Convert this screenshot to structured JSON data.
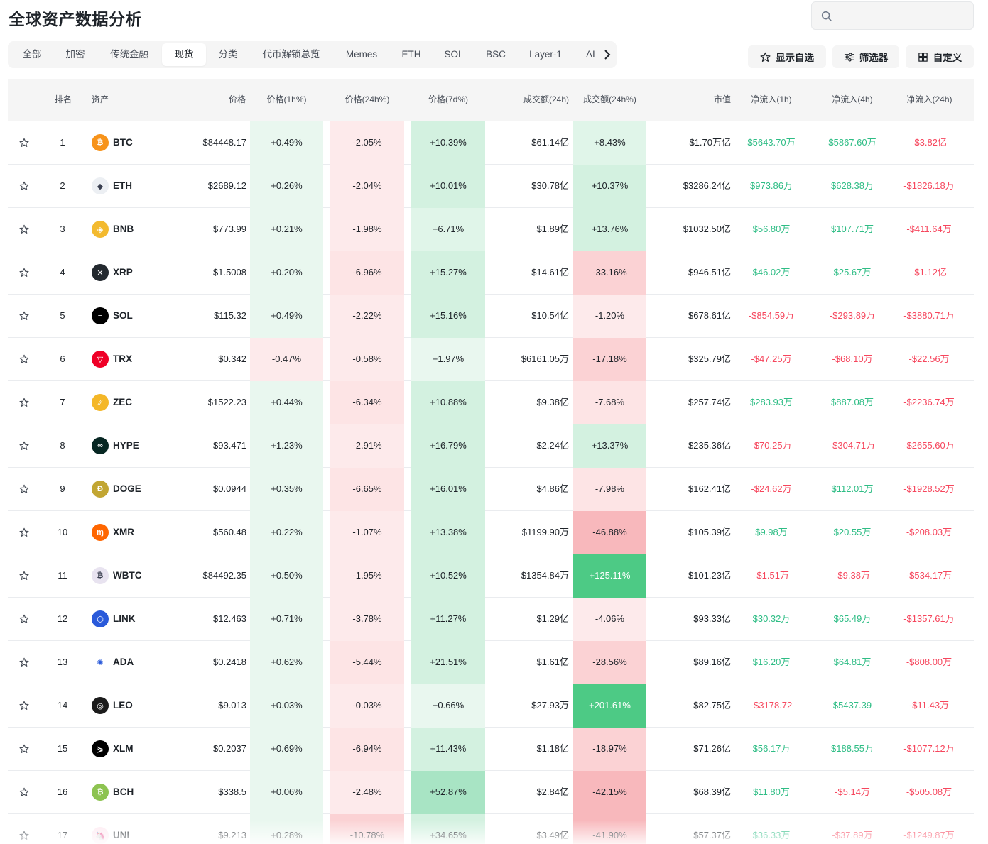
{
  "page": {
    "title": "全球资产数据分析"
  },
  "search": {
    "placeholder": ""
  },
  "tabs": [
    "全部",
    "加密",
    "传统金融",
    "现货",
    "分类",
    "代币解锁总览",
    "Memes",
    "ETH",
    "SOL",
    "BSC",
    "Layer-1",
    "AI"
  ],
  "active_tab": "现货",
  "toolbar": {
    "watchlist": "显示自选",
    "filter": "筛选器",
    "customize": "自定义"
  },
  "headers": {
    "rank": "排名",
    "asset": "资产",
    "price": "价格",
    "chg1h": "价格(1h%)",
    "chg24h": "价格(24h%)",
    "chg7d": "价格(7d%)",
    "vol": "成交额(24h)",
    "volchg": "成交额(24h%)",
    "mcap": "市值",
    "flow1h": "净流入(1h)",
    "flow4h": "净流入(4h)",
    "flow24h": "净流入(24h)"
  },
  "colors": {
    "up": "#2ebd85",
    "down": "#f6465d"
  },
  "rows": [
    {
      "rank": "1",
      "symbol": "BTC",
      "icon": "bitcoin-icon",
      "icon_color": "#f7931a",
      "glyph": "₿",
      "price": "$84448.17",
      "chg1h": "+0.49%",
      "chg24h": "-2.05%",
      "chg7d": "+10.39%",
      "vol": "$61.14亿",
      "volchg": "+8.43%",
      "mcap": "$1.70万亿",
      "flow1h": "$5643.70万",
      "flow4h": "$5867.60万",
      "flow24h": "-$3.82亿"
    },
    {
      "rank": "2",
      "symbol": "ETH",
      "icon": "ethereum-icon",
      "icon_color": "#eceff3",
      "glyph": "◆",
      "price": "$2689.12",
      "chg1h": "+0.26%",
      "chg24h": "-2.04%",
      "chg7d": "+10.01%",
      "vol": "$30.78亿",
      "volchg": "+10.37%",
      "mcap": "$3286.24亿",
      "flow1h": "$973.86万",
      "flow4h": "$628.38万",
      "flow24h": "-$1826.18万"
    },
    {
      "rank": "3",
      "symbol": "BNB",
      "icon": "bnb-icon",
      "icon_color": "#f3ba2f",
      "glyph": "◈",
      "price": "$773.99",
      "chg1h": "+0.21%",
      "chg24h": "-1.98%",
      "chg7d": "+6.71%",
      "vol": "$1.89亿",
      "volchg": "+13.76%",
      "mcap": "$1032.50亿",
      "flow1h": "$56.80万",
      "flow4h": "$107.71万",
      "flow24h": "-$411.64万"
    },
    {
      "rank": "4",
      "symbol": "XRP",
      "icon": "xrp-icon",
      "icon_color": "#23292f",
      "glyph": "✕",
      "price": "$1.5008",
      "chg1h": "+0.20%",
      "chg24h": "-6.96%",
      "chg7d": "+15.27%",
      "vol": "$14.61亿",
      "volchg": "-33.16%",
      "mcap": "$946.51亿",
      "flow1h": "$46.02万",
      "flow4h": "$25.67万",
      "flow24h": "-$1.12亿"
    },
    {
      "rank": "5",
      "symbol": "SOL",
      "icon": "solana-icon",
      "icon_color": "#000000",
      "glyph": "≡",
      "price": "$115.32",
      "chg1h": "+0.49%",
      "chg24h": "-2.22%",
      "chg7d": "+15.16%",
      "vol": "$10.54亿",
      "volchg": "-1.20%",
      "mcap": "$678.61亿",
      "flow1h": "-$854.59万",
      "flow4h": "-$293.89万",
      "flow24h": "-$3880.71万"
    },
    {
      "rank": "6",
      "symbol": "TRX",
      "icon": "tron-icon",
      "icon_color": "#ef0027",
      "glyph": "▽",
      "price": "$0.342",
      "chg1h": "-0.47%",
      "chg24h": "-0.58%",
      "chg7d": "+1.97%",
      "vol": "$6161.05万",
      "volchg": "-17.18%",
      "mcap": "$325.79亿",
      "flow1h": "-$47.25万",
      "flow4h": "-$68.10万",
      "flow24h": "-$22.56万"
    },
    {
      "rank": "7",
      "symbol": "ZEC",
      "icon": "zcash-icon",
      "icon_color": "#f4b728",
      "glyph": "ℤ",
      "price": "$1522.23",
      "chg1h": "+0.44%",
      "chg24h": "-6.34%",
      "chg7d": "+10.88%",
      "vol": "$9.38亿",
      "volchg": "-7.68%",
      "mcap": "$257.74亿",
      "flow1h": "$283.93万",
      "flow4h": "$887.08万",
      "flow24h": "-$2236.74万"
    },
    {
      "rank": "8",
      "symbol": "HYPE",
      "icon": "hyperliquid-icon",
      "icon_color": "#072723",
      "glyph": "∞",
      "price": "$93.471",
      "chg1h": "+1.23%",
      "chg24h": "-2.91%",
      "chg7d": "+16.79%",
      "vol": "$2.24亿",
      "volchg": "+13.37%",
      "mcap": "$235.36亿",
      "flow1h": "-$70.25万",
      "flow4h": "-$304.71万",
      "flow24h": "-$2655.60万"
    },
    {
      "rank": "9",
      "symbol": "DOGE",
      "icon": "dogecoin-icon",
      "icon_color": "#c2a633",
      "glyph": "Ð",
      "price": "$0.0944",
      "chg1h": "+0.35%",
      "chg24h": "-6.65%",
      "chg7d": "+16.01%",
      "vol": "$4.86亿",
      "volchg": "-7.98%",
      "mcap": "$162.41亿",
      "flow1h": "-$24.62万",
      "flow4h": "$112.01万",
      "flow24h": "-$1928.52万"
    },
    {
      "rank": "10",
      "symbol": "XMR",
      "icon": "monero-icon",
      "icon_color": "#ff6600",
      "glyph": "ɱ",
      "price": "$560.48",
      "chg1h": "+0.22%",
      "chg24h": "-1.07%",
      "chg7d": "+13.38%",
      "vol": "$1199.90万",
      "volchg": "-46.88%",
      "mcap": "$105.39亿",
      "flow1h": "$9.98万",
      "flow4h": "$20.55万",
      "flow24h": "-$208.03万"
    },
    {
      "rank": "11",
      "symbol": "WBTC",
      "icon": "wrapped-bitcoin-icon",
      "icon_color": "#e8e3f0",
      "glyph": "₿",
      "price": "$84492.35",
      "chg1h": "+0.50%",
      "chg24h": "-1.95%",
      "chg7d": "+10.52%",
      "vol": "$1354.84万",
      "volchg": "+125.11%",
      "mcap": "$101.23亿",
      "flow1h": "-$1.51万",
      "flow4h": "-$9.38万",
      "flow24h": "-$534.17万"
    },
    {
      "rank": "12",
      "symbol": "LINK",
      "icon": "chainlink-icon",
      "icon_color": "#2a5ada",
      "glyph": "⬡",
      "price": "$12.463",
      "chg1h": "+0.71%",
      "chg24h": "-3.78%",
      "chg7d": "+11.27%",
      "vol": "$1.29亿",
      "volchg": "-4.06%",
      "mcap": "$93.33亿",
      "flow1h": "$30.32万",
      "flow4h": "$65.49万",
      "flow24h": "-$1357.61万"
    },
    {
      "rank": "13",
      "symbol": "ADA",
      "icon": "cardano-icon",
      "icon_color": "#ffffff",
      "glyph": "✺",
      "price": "$0.2418",
      "chg1h": "+0.62%",
      "chg24h": "-5.44%",
      "chg7d": "+21.51%",
      "vol": "$1.61亿",
      "volchg": "-28.56%",
      "mcap": "$89.16亿",
      "flow1h": "$16.20万",
      "flow4h": "$64.81万",
      "flow24h": "-$808.00万"
    },
    {
      "rank": "14",
      "symbol": "LEO",
      "icon": "leo-icon",
      "icon_color": "#1c1c1c",
      "glyph": "◎",
      "price": "$9.013",
      "chg1h": "+0.03%",
      "chg24h": "-0.03%",
      "chg7d": "+0.66%",
      "vol": "$27.93万",
      "volchg": "+201.61%",
      "mcap": "$82.75亿",
      "flow1h": "-$3178.72",
      "flow4h": "$5437.39",
      "flow24h": "-$11.43万"
    },
    {
      "rank": "15",
      "symbol": "XLM",
      "icon": "stellar-icon",
      "icon_color": "#000000",
      "glyph": "⋟",
      "price": "$0.2037",
      "chg1h": "+0.69%",
      "chg24h": "-6.94%",
      "chg7d": "+11.43%",
      "vol": "$1.18亿",
      "volchg": "-18.97%",
      "mcap": "$71.26亿",
      "flow1h": "$56.17万",
      "flow4h": "$188.55万",
      "flow24h": "-$1077.12万"
    },
    {
      "rank": "16",
      "symbol": "BCH",
      "icon": "bitcoin-cash-icon",
      "icon_color": "#8dc351",
      "glyph": "₿",
      "price": "$338.5",
      "chg1h": "+0.06%",
      "chg24h": "-2.48%",
      "chg7d": "+52.87%",
      "vol": "$2.84亿",
      "volchg": "-42.15%",
      "mcap": "$68.39亿",
      "flow1h": "$11.80万",
      "flow4h": "-$5.14万",
      "flow24h": "-$505.08万"
    },
    {
      "rank": "17",
      "symbol": "UNI",
      "icon": "uniswap-icon",
      "icon_color": "#fdeaf1",
      "glyph": "🦄",
      "price": "$9.213",
      "chg1h": "+0.28%",
      "chg24h": "-10.78%",
      "chg7d": "+34.65%",
      "vol": "$3.49亿",
      "volchg": "-41.90%",
      "mcap": "$57.37亿",
      "flow1h": "$36.33万",
      "flow4h": "-$37.89万",
      "flow24h": "-$1249.87万"
    }
  ]
}
